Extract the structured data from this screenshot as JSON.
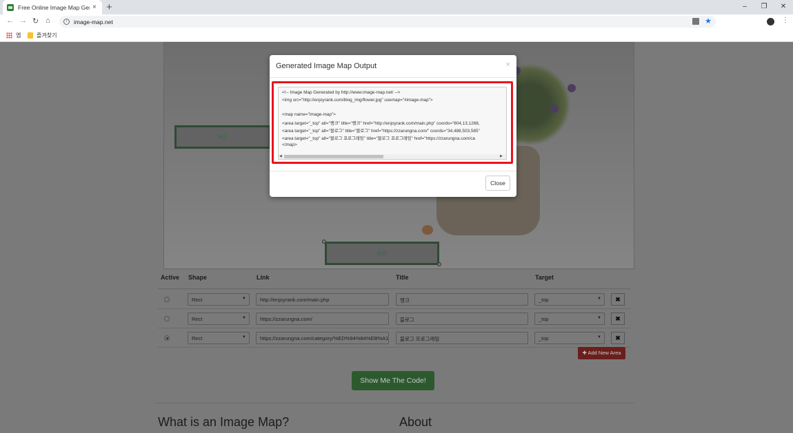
{
  "browser": {
    "tab_title": "Free Online Image Map Generator",
    "tab_close": "×",
    "new_tab": "+",
    "url": "image-map.net",
    "bookmarks": {
      "apps_label": "앱",
      "favorites_label": "즐겨찾기"
    },
    "window_controls": [
      "–",
      "❐",
      "✕"
    ]
  },
  "image_areas": [
    {
      "label": "버튼"
    },
    {
      "label": "버튼"
    }
  ],
  "table": {
    "headers": {
      "active": "Active",
      "shape": "Shape",
      "link": "Link",
      "title": "Title",
      "target": "Target"
    },
    "rows": [
      {
        "active": false,
        "shape": "Rect",
        "link": "http://enjoyrank.com/main.php",
        "title": "랭크",
        "target": "_top"
      },
      {
        "active": false,
        "shape": "Rect",
        "link": "https://zzarungna.com/",
        "title": "블로그",
        "target": "_top"
      },
      {
        "active": true,
        "shape": "Rect",
        "link": "https://zzarungna.com/category/%ED%94%84%EB%A1",
        "title": "블로그 프로그래밍",
        "target": "_top"
      }
    ],
    "delete_icon": "✖"
  },
  "buttons": {
    "add_new_area": "✚ Add New Area",
    "show_code": "Show Me The Code!"
  },
  "headings": {
    "what_is": "What is an Image Map?",
    "about": "About"
  },
  "modal": {
    "title": "Generated Image Map Output",
    "close_x": "×",
    "close_button": "Close",
    "code_lines": [
      "<!-- Image Map Generated by http://www.image-map.net/ -->",
      "<img src=\"http://enjoyrank.com/blog_img/flower.jpg\" usemap=\"#image-map\">",
      "",
      "<map name=\"image-map\">",
      "    <area target=\"_top\" alt=\"랭크\" title=\"랭크\" href=\"http://enjoyrank.com/main.php\" coords=\"804,13,1268,",
      "    <area target=\"_top\" alt=\"블로그\" title=\"블로그\" href=\"https://zzarungna.com/\" coords=\"34,488,503,585\"",
      "    <area target=\"_top\" alt=\"블로그 프로그래밍\" title=\"블로그 프로그래밍\" href=\"https://zzarungna.com/ca",
      "</map>"
    ]
  },
  "colors": {
    "highlight": "#e8141e",
    "show_button": "#2c5a2e",
    "add_button": "#6a1f1d"
  }
}
